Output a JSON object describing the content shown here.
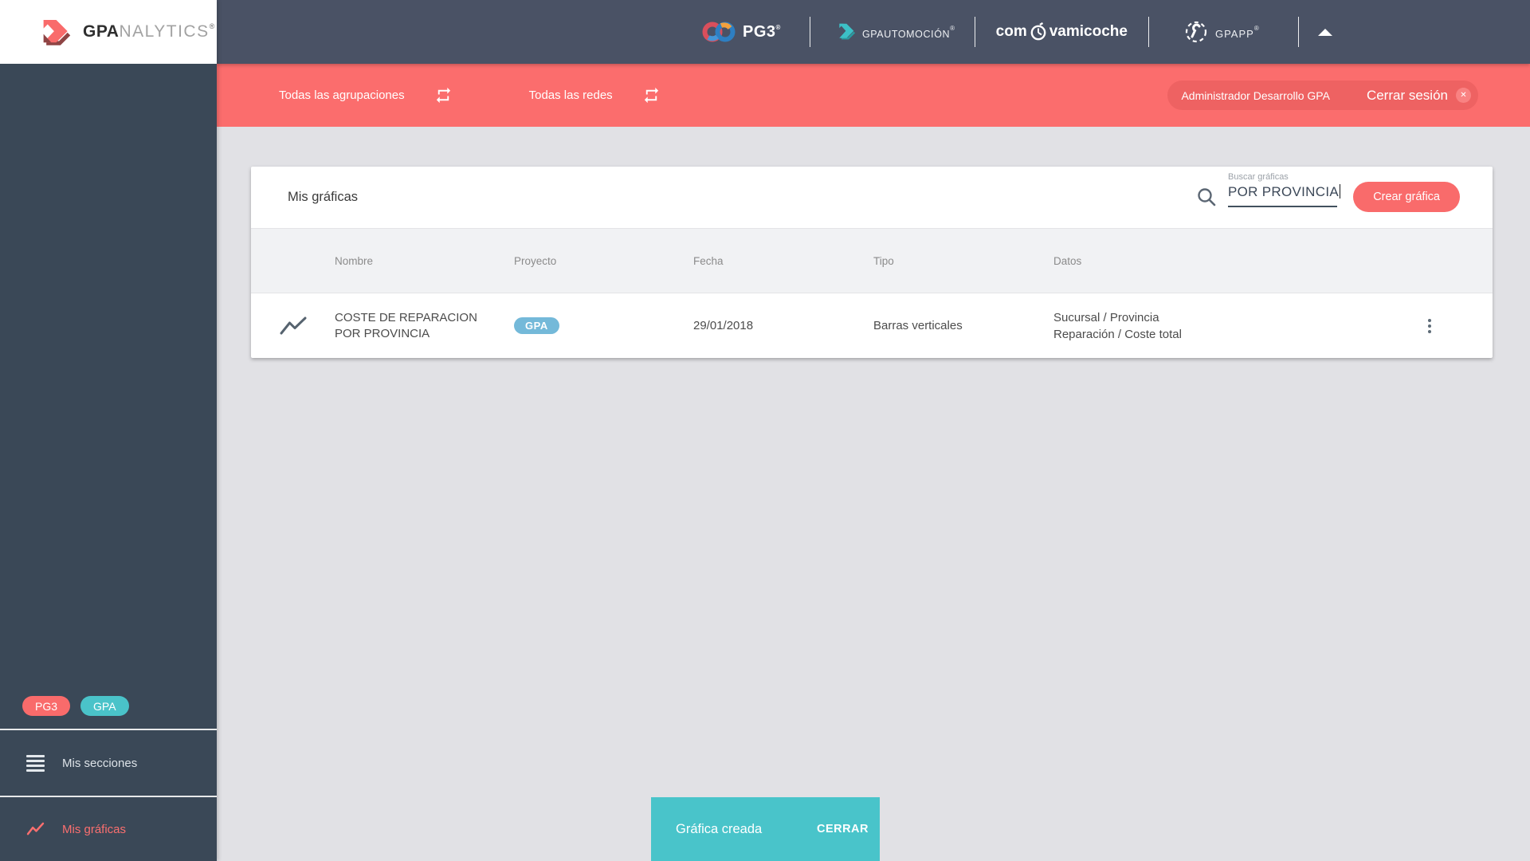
{
  "app": {
    "brand_bold": "GPA",
    "brand_light": "NALYTICS",
    "brand_reg": "®"
  },
  "topbar": {
    "pg3_label": "PG3",
    "pg3_sup": "®",
    "auto_label": "GPAUTOMOCIÓN",
    "auto_sup": "®",
    "coche_pre": "com",
    "coche_post": "vamicoche",
    "app_label": "GPAPP",
    "app_sup": "®"
  },
  "filterbar": {
    "groups_label": "Todas las agrupaciones",
    "networks_label": "Todas las redes",
    "user_name": "Administrador Desarrollo GPA",
    "logout_label": "Cerrar sesión",
    "logout_x": "✕"
  },
  "sidebar": {
    "badge_pg3": "PG3",
    "badge_gpa": "GPA",
    "sections_label": "Mis secciones",
    "charts_label": "Mis gráficas"
  },
  "panel": {
    "title": "Mis gráficas",
    "search_label": "Buscar gráficas",
    "search_value": "POR PROVINCIA",
    "create_label": "Crear gráfica",
    "table": {
      "headers": [
        "Nombre",
        "Proyecto",
        "Fecha",
        "Tipo",
        "Datos"
      ],
      "rows": [
        {
          "name": "COSTE DE REPARACION POR PROVINCIA",
          "project": "GPA",
          "date": "29/01/2018",
          "type": "Barras verticales",
          "data_line1": "Sucursal / Provincia",
          "data_line2": "Reparación / Coste total"
        }
      ]
    }
  },
  "snackbar": {
    "message": "Gráfica creada",
    "action": "CERRAR"
  },
  "colors": {
    "coral": "#f96b6b",
    "coral_bar": "#fb6d6d",
    "coral_pill": "#ee6262",
    "teal": "#49c4ca",
    "badge_blue": "#74b9d9",
    "sidebar_bg": "#3a4857",
    "topbar_bg": "#4a5265",
    "page_bg": "#e1e1e5",
    "table_header_bg": "#f1f2f4"
  },
  "icons": {
    "gpa-logo-icon": "coral chevron arrow",
    "pg3-infinity-icon": "infinity loops",
    "automocion-arrow-icon": "teal chevron arrow",
    "clock-icon": "stopwatch",
    "wrench-icon": "wrench in dashed circle",
    "collapse-icon": "▲",
    "swap-icon": "repeat arrows",
    "search-icon": "magnifier",
    "chart-line-icon": "zigzag line",
    "menu-icon": "≡",
    "kebab-icon": "⋮"
  }
}
